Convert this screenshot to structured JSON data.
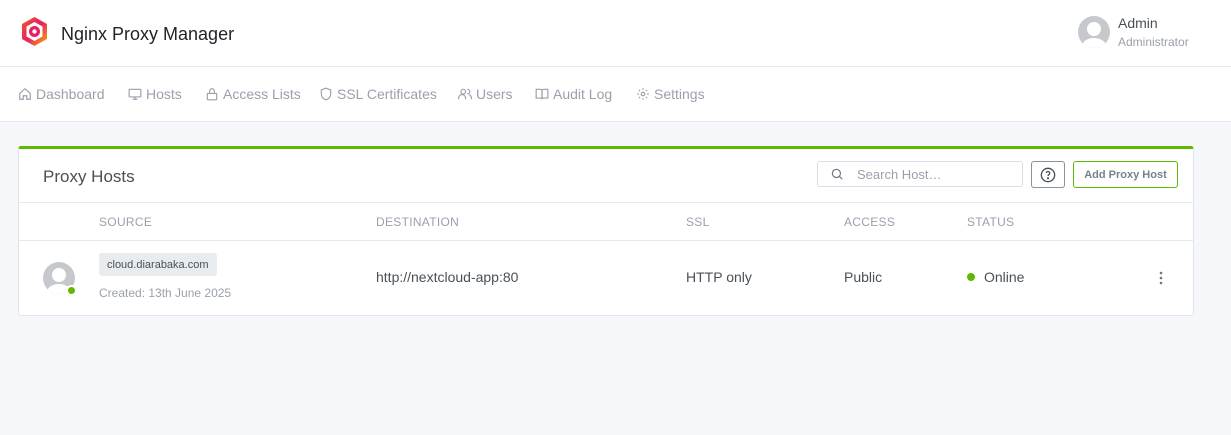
{
  "app": {
    "title": "Nginx Proxy Manager"
  },
  "user": {
    "name": "Admin",
    "role": "Administrator"
  },
  "nav": {
    "items": [
      {
        "label": "Dashboard",
        "icon": "home-icon"
      },
      {
        "label": "Hosts",
        "icon": "monitor-icon"
      },
      {
        "label": "Access Lists",
        "icon": "lock-icon"
      },
      {
        "label": "SSL Certificates",
        "icon": "shield-icon"
      },
      {
        "label": "Users",
        "icon": "users-icon"
      },
      {
        "label": "Audit Log",
        "icon": "book-icon"
      },
      {
        "label": "Settings",
        "icon": "gear-icon"
      }
    ]
  },
  "card": {
    "title": "Proxy Hosts",
    "search_placeholder": "Search Host…",
    "add_label": "Add Proxy Host",
    "columns": [
      "SOURCE",
      "DESTINATION",
      "SSL",
      "ACCESS",
      "STATUS"
    ]
  },
  "rows": [
    {
      "domain": "cloud.diarabaka.com",
      "created": "Created: 13th June 2025",
      "destination": "http://nextcloud-app:80",
      "ssl": "HTTP only",
      "access": "Public",
      "status": "Online"
    }
  ],
  "colors": {
    "accent": "#5eba00",
    "muted": "#9aa0ac",
    "text": "#495057"
  }
}
